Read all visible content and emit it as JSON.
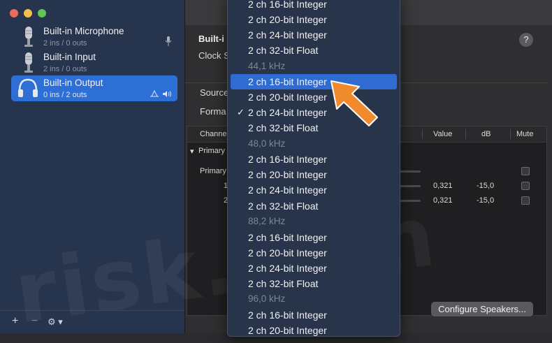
{
  "sidebar": {
    "devices": [
      {
        "name": "Built-in Microphone",
        "sub": "2 ins / 0 outs",
        "icon": "microphone-icon"
      },
      {
        "name": "Built-in Input",
        "sub": "2 ins / 0 outs",
        "icon": "microphone-icon"
      },
      {
        "name": "Built-in Output",
        "sub": "0 ins / 2 outs",
        "icon": "headphones-icon",
        "selected": true
      }
    ],
    "footer": {
      "add": "+",
      "remove": "−",
      "gear": "⚙︎ ▾"
    }
  },
  "main": {
    "header_title": "Built-i",
    "clock_label": "Clock S",
    "source_label": "Source",
    "format_label": "Forma",
    "help": "?",
    "table": {
      "headers": [
        "Channe",
        "Value",
        "dB",
        "Mute"
      ],
      "group": "Primary",
      "rows": [
        {
          "label": "Primary",
          "value": "",
          "db": ""
        },
        {
          "label": "1",
          "value": "0,321",
          "db": "-15,0"
        },
        {
          "label": "2",
          "value": "0,321",
          "db": "-15,0"
        }
      ],
      "group_prefix": "▾ "
    },
    "configure_button": "Configure Speakers..."
  },
  "dropdown": {
    "items": [
      {
        "text": "2 ch 16-bit Integer"
      },
      {
        "text": "2 ch 20-bit Integer"
      },
      {
        "text": "2 ch 24-bit Integer"
      },
      {
        "text": "2 ch 32-bit Float"
      },
      {
        "text": "44,1 kHz",
        "header": true
      },
      {
        "text": "2 ch 16-bit Integer",
        "highlight": true
      },
      {
        "text": "2 ch 20-bit Integer"
      },
      {
        "text": "2 ch 24-bit Integer",
        "checked": true
      },
      {
        "text": "2 ch 32-bit Float"
      },
      {
        "text": "48,0 kHz",
        "header": true
      },
      {
        "text": "2 ch 16-bit Integer"
      },
      {
        "text": "2 ch 20-bit Integer"
      },
      {
        "text": "2 ch 24-bit Integer"
      },
      {
        "text": "2 ch 32-bit Float"
      },
      {
        "text": "88,2 kHz",
        "header": true
      },
      {
        "text": "2 ch 16-bit Integer"
      },
      {
        "text": "2 ch 20-bit Integer"
      },
      {
        "text": "2 ch 24-bit Integer"
      },
      {
        "text": "2 ch 32-bit Float"
      },
      {
        "text": "96,0 kHz",
        "header": true
      },
      {
        "text": "2 ch 16-bit Integer"
      },
      {
        "text": "2 ch 20-bit Integer"
      }
    ],
    "check_glyph": "✓"
  },
  "watermark": "risk.com",
  "colors": {
    "selection": "#2e6fd6",
    "arrow": "#f08a2c"
  }
}
